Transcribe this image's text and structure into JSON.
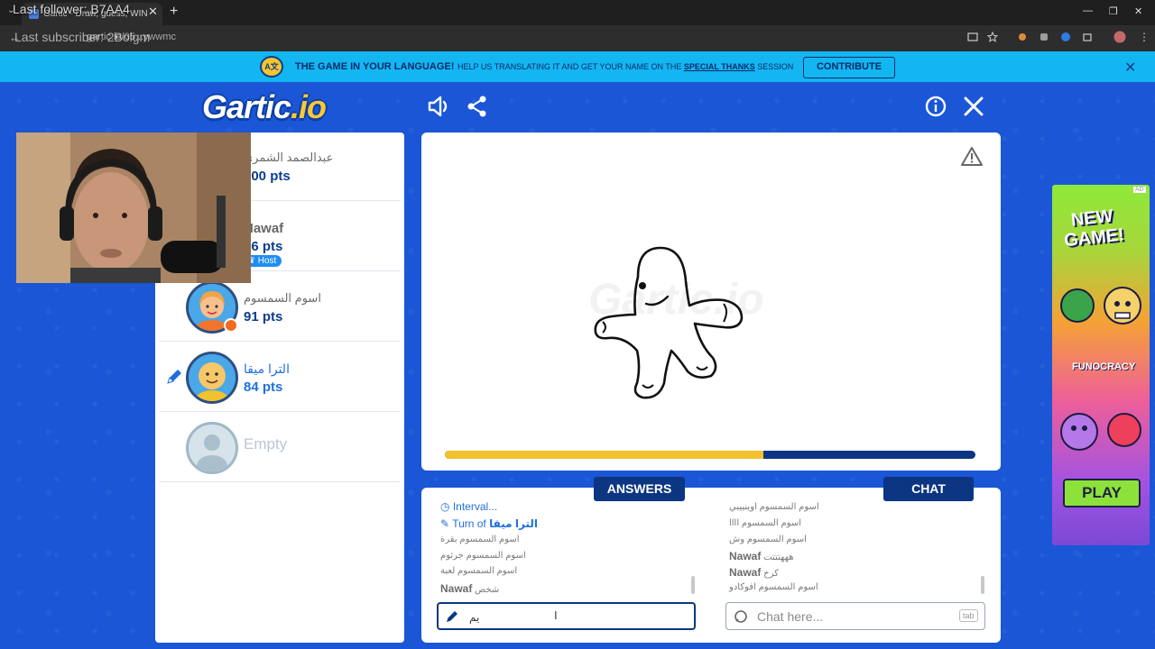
{
  "browser": {
    "tab_title": "Gartic - Draw, guess, WIN",
    "url": "gartic.io/05...ywwmc",
    "overlay_follower": "Last follower: B7AA4",
    "overlay_subscriber": "Last subscriber: 2Bolgm"
  },
  "banner": {
    "emblem": "A文",
    "title": "THE GAME IN YOUR LANGUAGE!",
    "help_prefix": "HELP US TRANSLATING IT AND GET YOUR NAME ON THE",
    "help_link": "SPECIAL THANKS",
    "help_suffix": "SESSION",
    "contribute_label": "CONTRIBUTE"
  },
  "header": {
    "logo_main": "Gartic",
    "logo_tail": ".io"
  },
  "players": [
    {
      "name": "عبدالصمد الشمري",
      "points": "100 pts",
      "host": false,
      "drawing": false
    },
    {
      "name": "Nawaf",
      "points": "96 pts",
      "host": true,
      "drawing": false
    },
    {
      "name": "اسوم السمسوم",
      "points": "91 pts",
      "host": false,
      "drawing": false
    },
    {
      "name": "الترا ميقا",
      "points": "84 pts",
      "host": false,
      "drawing": true
    },
    {
      "name": "Empty",
      "points": "",
      "host": false,
      "drawing": false
    }
  ],
  "host_label": "Host",
  "board": {
    "watermark": "Gartic.io",
    "timer_progress": 0.6
  },
  "answers": {
    "tag": "ANSWERS",
    "messages": [
      {
        "type": "system",
        "text": "Interval..."
      },
      {
        "type": "turn",
        "prefix": "Turn of",
        "name": "الترا ميقا"
      },
      {
        "type": "guess",
        "name": "اسوم السمسوم",
        "text": "بقرة"
      },
      {
        "type": "guess",
        "name": "اسوم السمسوم",
        "text": "جرثوم"
      },
      {
        "type": "guess",
        "name": "اسوم السمسوم",
        "text": "لعبة"
      },
      {
        "type": "guess",
        "name": "Nawaf",
        "text": "شخص"
      }
    ],
    "input_value": "يم"
  },
  "chat": {
    "tag": "CHAT",
    "messages": [
      {
        "name": "اسوم السمسوم",
        "text": "اوينييبي"
      },
      {
        "name": "اسوم السمسوم",
        "text": "اااا"
      },
      {
        "name": "اسوم السمسوم",
        "text": "وش"
      },
      {
        "name": "Nawaf",
        "text": "هههتتتت"
      },
      {
        "name": "Nawaf",
        "text": "كرخ"
      },
      {
        "name": "اسوم السمسوم",
        "text": "افوكادو"
      }
    ],
    "placeholder": "Chat here...",
    "tab_hint": "tab"
  },
  "ad": {
    "headline_line1": "NEW",
    "headline_line2": "GAME!",
    "brand": "FUNOCRACY",
    "play_label": "PLAY",
    "ad_mark": "AD"
  },
  "colors": {
    "page_bg": "#1a56d6",
    "banner_bg": "#13b6f0",
    "navy": "#0c3682",
    "timer": "#f2c12e",
    "host_badge": "#1f8ef1",
    "accent_orange": "#f26b1d"
  }
}
